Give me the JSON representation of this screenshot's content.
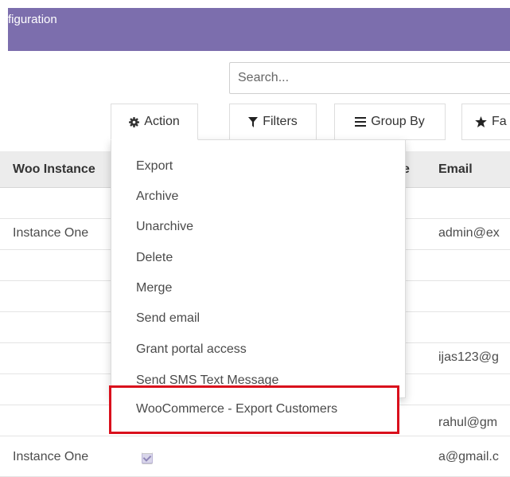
{
  "header": {
    "title": "figuration"
  },
  "search": {
    "placeholder": "Search..."
  },
  "toolbar": {
    "action_label": "Action",
    "filters_label": "Filters",
    "groupby_label": "Group By",
    "favorites_label": "Fa"
  },
  "table": {
    "columns": [
      "Woo Instance",
      "e",
      "Email"
    ],
    "rows": [
      {
        "instance": "",
        "email": ""
      },
      {
        "instance": "Instance One",
        "email": "admin@ex"
      },
      {
        "instance": "",
        "email": ""
      },
      {
        "instance": "",
        "email": ""
      },
      {
        "instance": "",
        "email": ""
      },
      {
        "instance": "",
        "email": "ijas123@g"
      },
      {
        "instance": "",
        "email": ""
      },
      {
        "instance": "",
        "email": "rahul@gm"
      },
      {
        "instance": "Instance One",
        "email": "a@gmail.c"
      }
    ]
  },
  "dropdown": {
    "items": [
      "Export",
      "Archive",
      "Unarchive",
      "Delete",
      "Merge",
      "Send email",
      "Grant portal access",
      "Send SMS Text Message",
      "WooCommerce - Export Customers"
    ]
  },
  "colors": {
    "header_bg": "#7c6ead",
    "highlight_border": "#d9101c"
  },
  "icons": {
    "action": "gear-icon",
    "filters": "filter-icon",
    "groupby": "list-icon",
    "favorites": "star-icon"
  }
}
